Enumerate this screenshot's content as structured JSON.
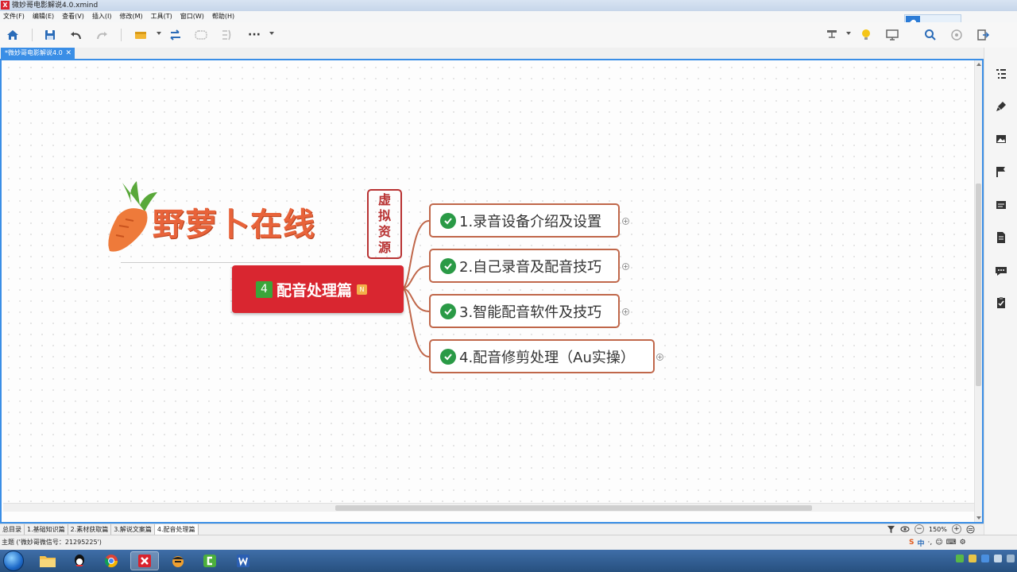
{
  "window": {
    "title": "微妙哥电影解说4.0.xmind",
    "app_icon": "X"
  },
  "menu": [
    "文件(F)",
    "编辑(E)",
    "查看(V)",
    "插入(I)",
    "修改(M)",
    "工具(T)",
    "窗口(W)",
    "帮助(H)"
  ],
  "toolbar": {
    "icons": [
      "home-icon",
      "save-icon",
      "undo-icon",
      "redo-icon",
      "insert-topic-icon",
      "relationship-icon",
      "boundary-icon",
      "summary-icon",
      "more-icon",
      "layout-icon",
      "idea-icon",
      "presentation-icon",
      "search-icon",
      "zoom-icon",
      "export-icon"
    ],
    "more_label": "···"
  },
  "cloud_icon": "cloud-icon",
  "doc_tab": {
    "label": "*微妙哥电影解说4.0",
    "close": "✕"
  },
  "logo": {
    "text": "野萝卜在线",
    "seal_chars": [
      "虚",
      "拟",
      "资",
      "源"
    ]
  },
  "central_topic": {
    "number": "4",
    "label": "配音处理篇",
    "note_marker": "N",
    "color": "#d92630"
  },
  "subtopics": [
    {
      "label": "1.录音设备介绍及设置"
    },
    {
      "label": "2.自己录音及配音技巧"
    },
    {
      "label": "3.智能配音软件及技巧"
    },
    {
      "label": "4.配音修剪处理（Au实操）"
    }
  ],
  "expand_symbol": "+",
  "sheet_tabs": [
    {
      "label": "总目录",
      "active": false
    },
    {
      "label": "1.基础知识篇",
      "active": false
    },
    {
      "label": "2.素材获取篇",
      "active": false
    },
    {
      "label": "3.解说文案篇",
      "active": false
    },
    {
      "label": "4.配音处理篇",
      "active": true
    }
  ],
  "zoom": {
    "level": "150%",
    "minus": "−",
    "plus": "+",
    "icons": [
      "filter-icon",
      "eye-icon",
      "zoom-out-icon",
      "zoom-in-icon",
      "fit-icon"
    ]
  },
  "right_panel_icons": [
    "outline-icon",
    "format-brush-icon",
    "image-icon",
    "marker-flag-icon",
    "note-icon",
    "document-icon",
    "comment-icon",
    "task-icon"
  ],
  "status": {
    "text": "主题 ('微妙哥微信号：21295225')",
    "ime": [
      "S",
      "中",
      "·,",
      "☺",
      "⌨",
      "⚙"
    ]
  },
  "taskbar": {
    "apps": [
      "file-explorer-icon",
      "qq-icon",
      "chrome-icon",
      "xmind-icon",
      "pirate-icon",
      "camtasia-icon",
      "word-icon"
    ],
    "active_app": "xmind-icon"
  },
  "colors": {
    "accent": "#3a8ee6",
    "topic_border": "#c0674a",
    "check": "#2a9a46",
    "logo_orange": "#e8633a"
  }
}
